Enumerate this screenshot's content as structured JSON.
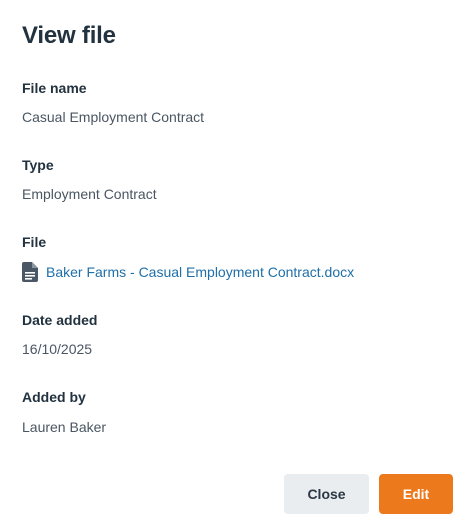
{
  "dialog": {
    "title": "View file",
    "fields": [
      {
        "label": "File name",
        "value": "Casual Employment Contract"
      },
      {
        "label": "Type",
        "value": "Employment Contract"
      },
      {
        "label": "File",
        "value": "Baker Farms - Casual Employment Contract.docx",
        "icon": "document-icon"
      },
      {
        "label": "Date added",
        "value": "16/10/2025"
      },
      {
        "label": "Added by",
        "value": "Lauren Baker"
      }
    ],
    "buttons": {
      "close_label": "Close",
      "edit_label": "Edit"
    }
  },
  "colors": {
    "primary": "#ec7a1c",
    "link": "#1f6fa8",
    "secondary_button": "#e9edf0"
  }
}
